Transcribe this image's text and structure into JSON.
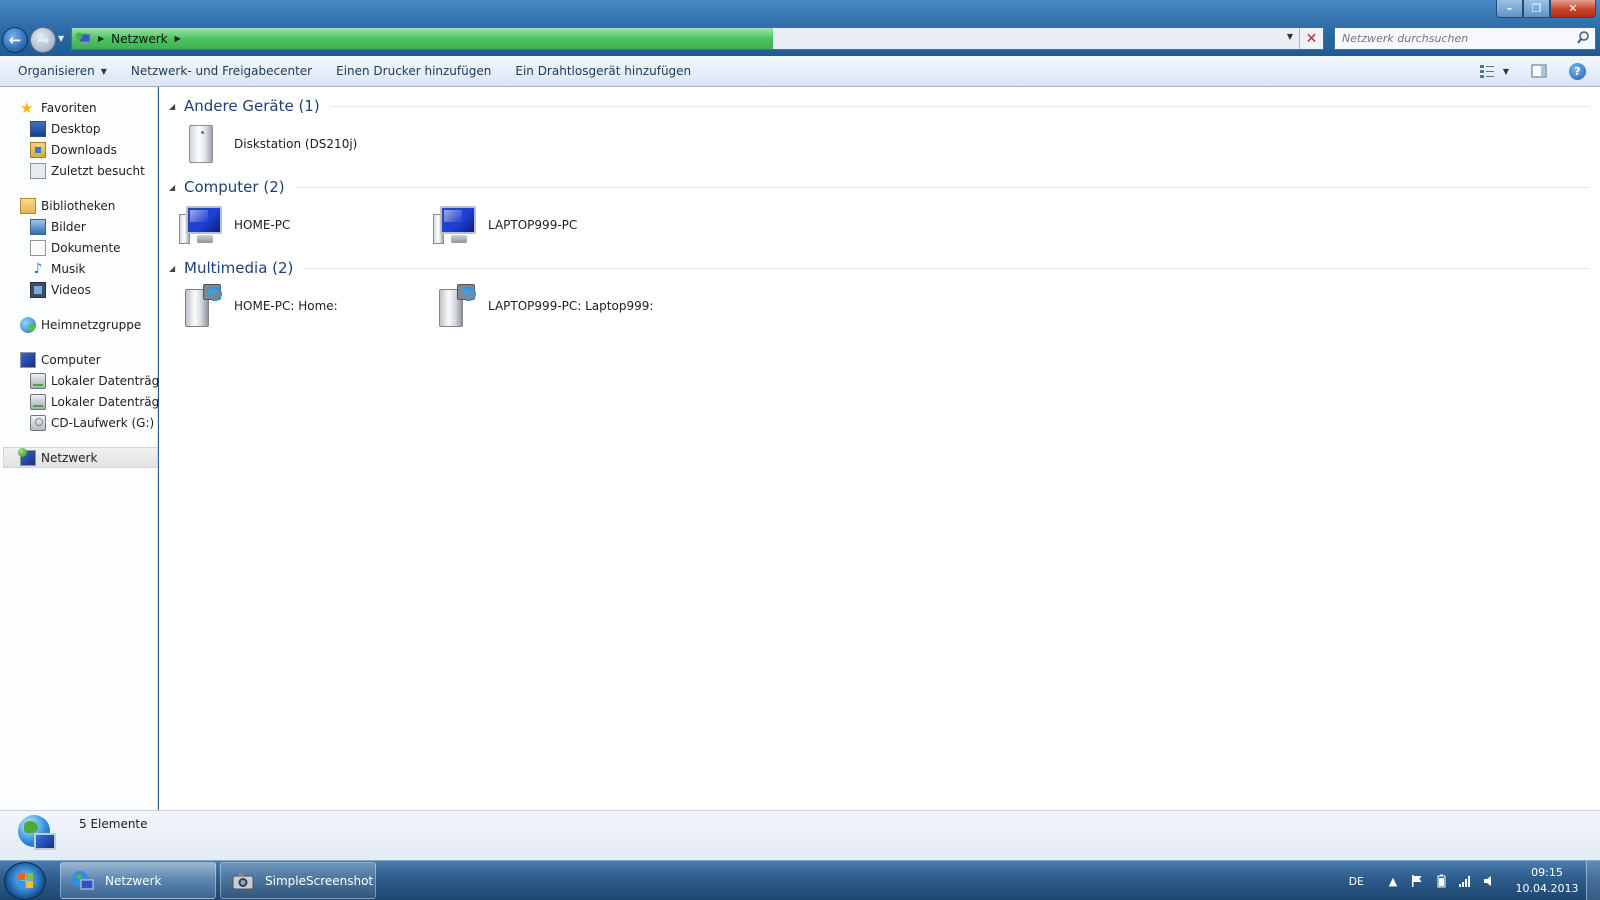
{
  "window": {
    "address": {
      "crumb": "Netzwerk",
      "progress_percent": 56
    },
    "search": {
      "placeholder": "Netzwerk durchsuchen"
    }
  },
  "toolbar": {
    "organize": "Organisieren",
    "network_center": "Netzwerk- und Freigabecenter",
    "add_printer": "Einen Drucker hinzufügen",
    "add_wireless": "Ein Drahtlosgerät hinzufügen",
    "help": "?"
  },
  "sidebar": {
    "favorites": {
      "label": "Favoriten",
      "items": [
        {
          "label": "Desktop",
          "icon": "desktop-icon"
        },
        {
          "label": "Downloads",
          "icon": "downloads-icon"
        },
        {
          "label": "Zuletzt besucht",
          "icon": "recent-places-icon"
        }
      ]
    },
    "libraries": {
      "label": "Bibliotheken",
      "items": [
        {
          "label": "Bilder",
          "icon": "pictures-icon"
        },
        {
          "label": "Dokumente",
          "icon": "documents-icon"
        },
        {
          "label": "Musik",
          "icon": "music-icon"
        },
        {
          "label": "Videos",
          "icon": "videos-icon"
        }
      ]
    },
    "homegroup": {
      "label": "Heimnetzgruppe"
    },
    "computer": {
      "label": "Computer",
      "items": [
        {
          "label": "Lokaler Datenträger",
          "icon": "hard-drive-icon"
        },
        {
          "label": "Lokaler Datenträger",
          "icon": "hard-drive-icon"
        },
        {
          "label": "CD-Laufwerk (G:)",
          "icon": "cd-drive-icon"
        }
      ]
    },
    "network": {
      "label": "Netzwerk"
    }
  },
  "content": {
    "groups": [
      {
        "label": "Andere Geräte (1)",
        "items": [
          {
            "label": "Diskstation (DS210j)",
            "icon": "nas-device-icon"
          }
        ]
      },
      {
        "label": "Computer (2)",
        "items": [
          {
            "label": "HOME-PC",
            "icon": "computer-icon"
          },
          {
            "label": "LAPTOP999-PC",
            "icon": "computer-icon"
          }
        ]
      },
      {
        "label": "Multimedia (2)",
        "items": [
          {
            "label": "HOME-PC: Home:",
            "icon": "media-server-icon"
          },
          {
            "label": "LAPTOP999-PC: Laptop999:",
            "icon": "media-server-icon"
          }
        ]
      }
    ]
  },
  "details": {
    "count": "5 Elemente"
  },
  "taskbar": {
    "items": [
      {
        "label": "Netzwerk",
        "active": true
      },
      {
        "label": "SimpleScreenshot",
        "active": false
      }
    ],
    "language": "DE",
    "time": "09:15",
    "date": "10.04.2013"
  }
}
